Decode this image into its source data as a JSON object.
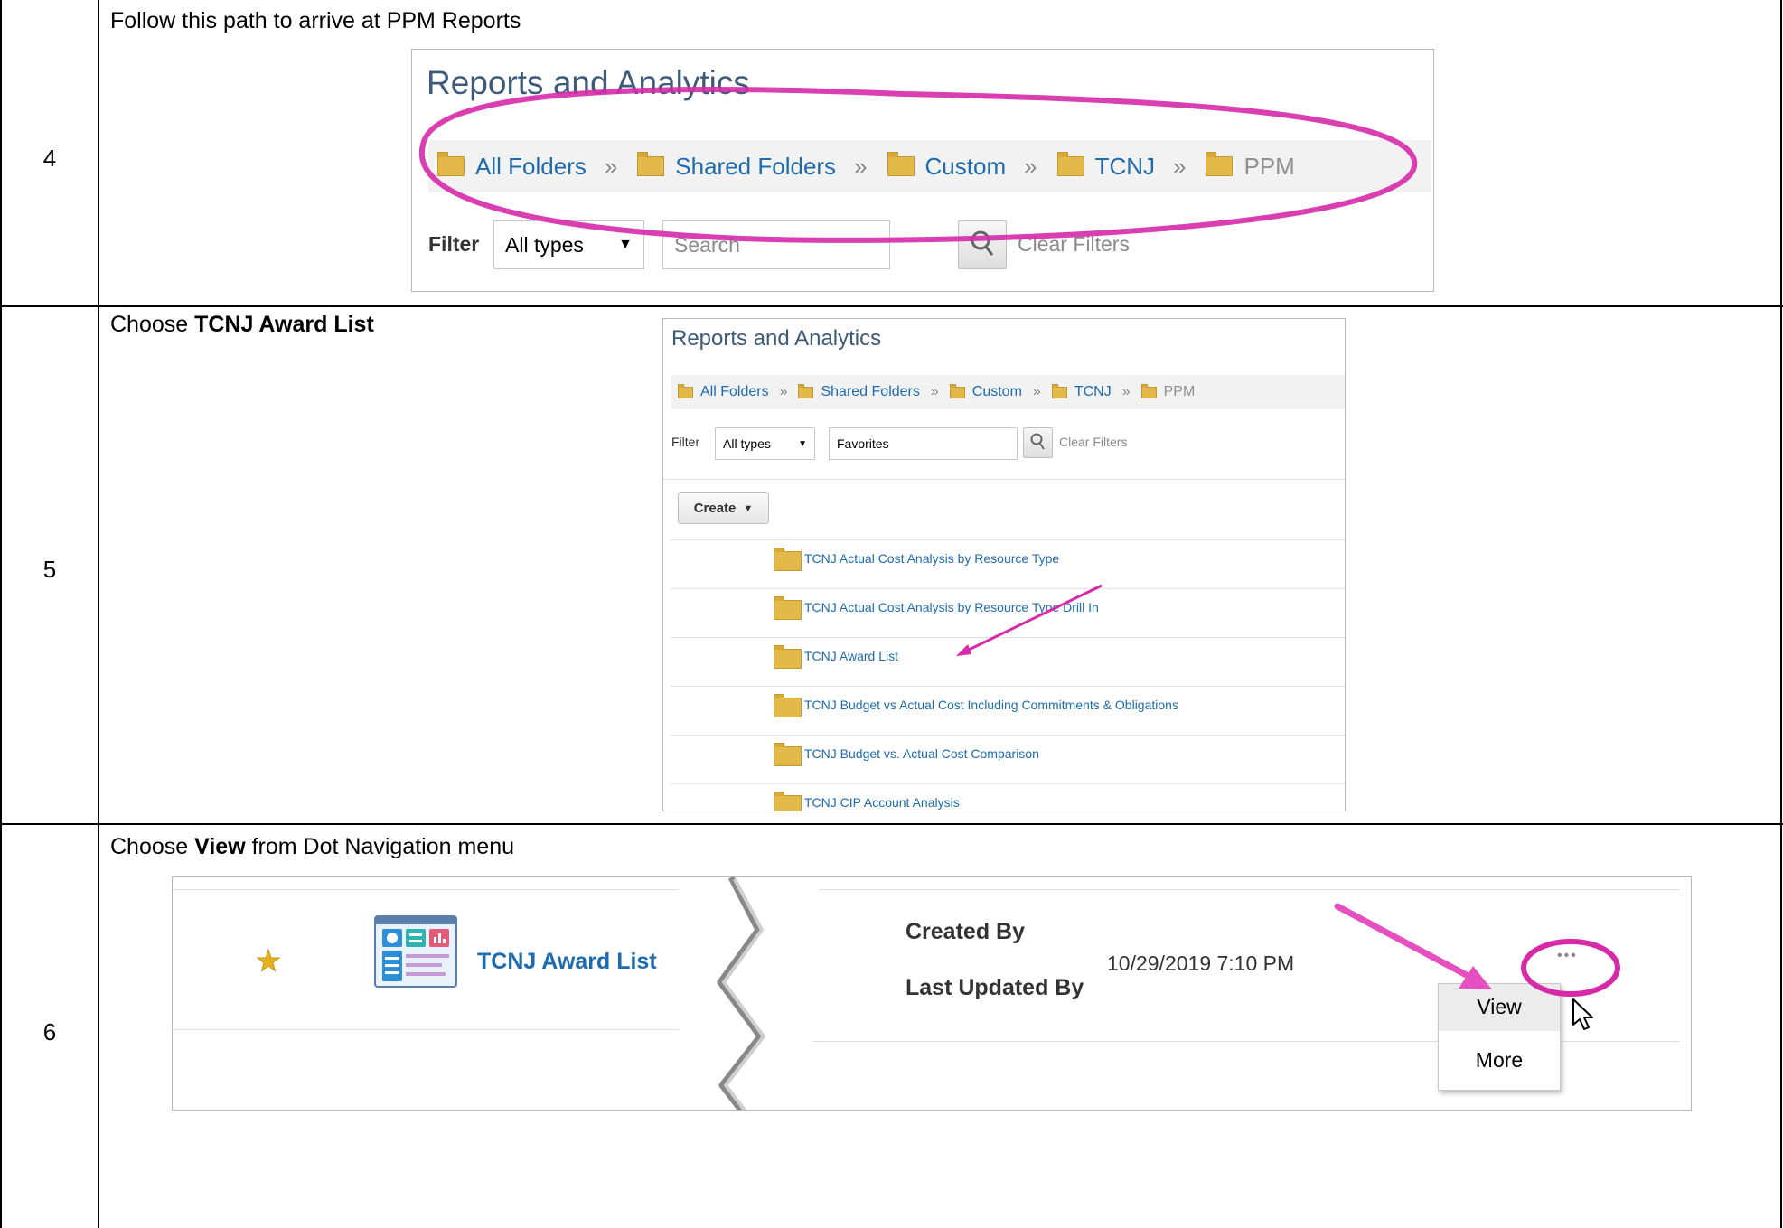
{
  "rows": [
    {
      "number": "4",
      "instruction": "Follow this path to arrive at PPM Reports"
    },
    {
      "number": "5",
      "instruction_prefix": "Choose ",
      "instruction_bold": "TCNJ Award List"
    },
    {
      "number": "6",
      "instruction_prefix": "Choose ",
      "instruction_bold": "View",
      "instruction_suffix": " from Dot Navigation menu"
    }
  ],
  "reports_screen": {
    "title": "Reports and Analytics",
    "breadcrumb": [
      "All Folders",
      "Shared Folders",
      "Custom",
      "TCNJ",
      "PPM"
    ],
    "separator": "»",
    "filter_label": "Filter",
    "type_select": "All types",
    "search_placeholder": "Search",
    "clear_filters": "Clear Filters"
  },
  "folder_screen": {
    "title": "Reports and Analytics",
    "breadcrumb": [
      "All Folders",
      "Shared Folders",
      "Custom",
      "TCNJ",
      "PPM"
    ],
    "separator": "»",
    "filter_label": "Filter",
    "type_select": "All types",
    "search_value": "Favorites",
    "clear_filters": "Clear Filters",
    "create_button": "Create",
    "items": [
      "TCNJ Actual Cost Analysis by Resource Type",
      "TCNJ Actual Cost Analysis by Resource Type Drill In",
      "TCNJ Award List",
      "TCNJ Budget vs Actual Cost Including Commitments & Obligations",
      "TCNJ Budget vs. Actual Cost Comparison",
      "TCNJ CIP Account Analysis"
    ]
  },
  "detail_screen": {
    "report_name": "TCNJ Award List",
    "created_by_label": "Created By",
    "last_updated_label": "Last Updated By",
    "timestamp": "10/29/2019 7:10 PM",
    "actions_button": "•••",
    "menu": [
      "View",
      "More"
    ]
  },
  "colors": {
    "highlight": "#d62aa8",
    "link": "#1e6bb0",
    "folder": "#e3b94a",
    "star": "#e8b21e"
  },
  "icons": [
    "folder-icon",
    "chevron-double-right-icon",
    "search-icon",
    "star-icon",
    "report-icon",
    "dropdown-arrow-icon",
    "cursor-icon",
    "arrow-icon"
  ]
}
